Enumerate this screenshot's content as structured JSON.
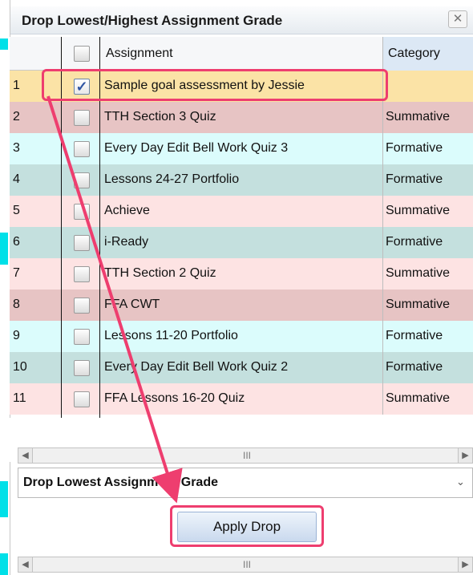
{
  "dialog": {
    "title": "Drop Lowest/Highest Assignment Grade",
    "close_symbol": "✕"
  },
  "grid": {
    "columns": {
      "assignment": "Assignment",
      "category": "Category"
    },
    "rows": [
      {
        "num": "1",
        "checked": true,
        "name": "Sample goal assessment by Jessie",
        "category": ""
      },
      {
        "num": "2",
        "checked": false,
        "name": "TTH Section 3 Quiz",
        "category": "Summative"
      },
      {
        "num": "3",
        "checked": false,
        "name": "Every Day Edit Bell Work Quiz 3",
        "category": "Formative"
      },
      {
        "num": "4",
        "checked": false,
        "name": "Lessons 24-27 Portfolio",
        "category": "Formative"
      },
      {
        "num": "5",
        "checked": false,
        "name": "Achieve",
        "category": "Summative"
      },
      {
        "num": "6",
        "checked": false,
        "name": "i-Ready",
        "category": "Formative"
      },
      {
        "num": "7",
        "checked": false,
        "name": "TTH Section 2 Quiz",
        "category": "Summative"
      },
      {
        "num": "8",
        "checked": false,
        "name": "FFA CWT",
        "category": "Summative"
      },
      {
        "num": "9",
        "checked": false,
        "name": "Lessons 11-20 Portfolio",
        "category": "Formative"
      },
      {
        "num": "10",
        "checked": false,
        "name": "Every Day Edit Bell Work Quiz 2",
        "category": "Formative"
      },
      {
        "num": "11",
        "checked": false,
        "name": "FFA Lessons 16-20 Quiz",
        "category": "Summative"
      }
    ],
    "row_colors": [
      "#fbe3a6",
      "#e7c4c4",
      "#dbfcfc",
      "#c4e0de",
      "#fde3e3",
      "#c4e0de",
      "#fde3e3",
      "#e7c4c4",
      "#dbfcfc",
      "#c4e0de",
      "#fde3e3"
    ]
  },
  "scrollbar": {
    "grip": "III"
  },
  "drop_select": {
    "value": "Drop Lowest Assignment Grade"
  },
  "apply_button": {
    "label": "Apply Drop"
  },
  "annotation_color": "#ee3e6f"
}
